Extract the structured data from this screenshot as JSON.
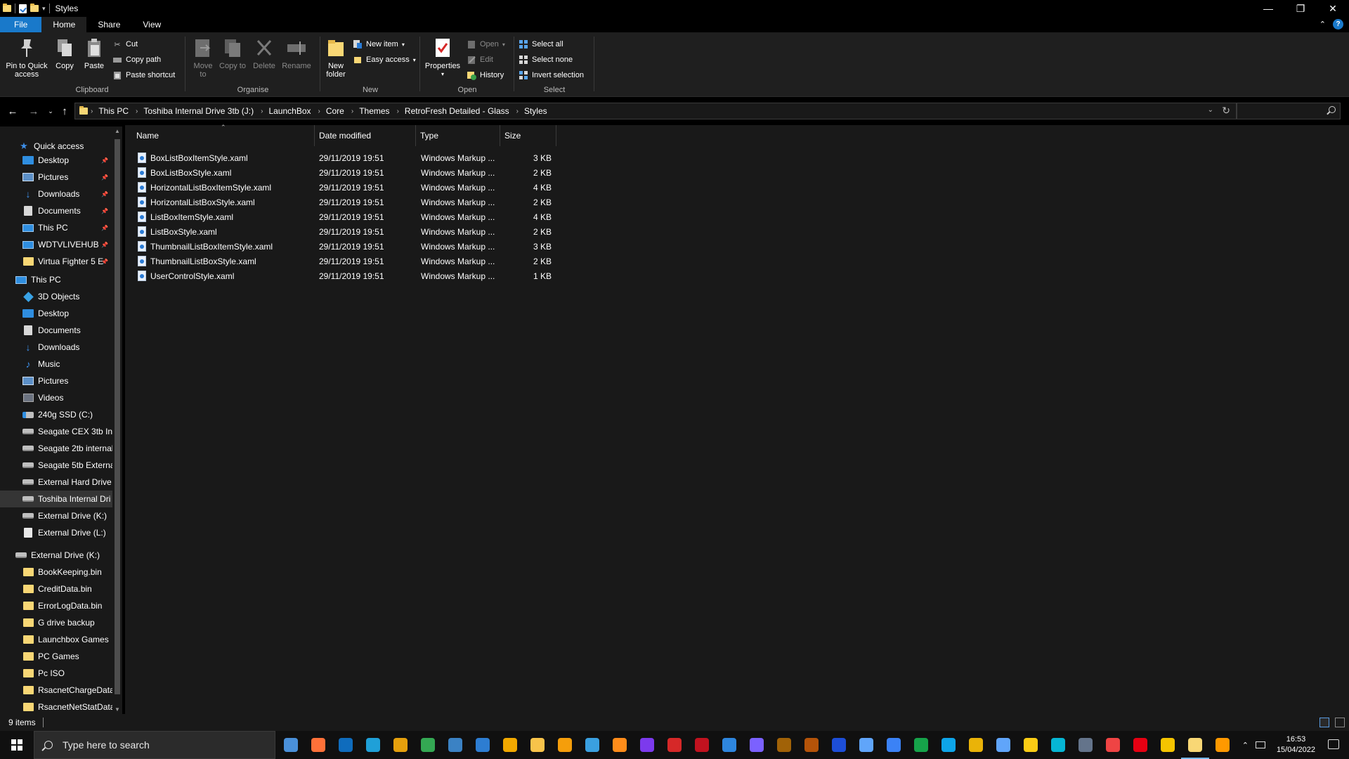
{
  "window": {
    "title": "Styles",
    "controls": {
      "minimize": "—",
      "maximize": "❐",
      "close": "✕"
    }
  },
  "ribbon_tabs": [
    {
      "label": "File"
    },
    {
      "label": "Home"
    },
    {
      "label": "Share"
    },
    {
      "label": "View"
    }
  ],
  "ribbon": {
    "clipboard": {
      "group_label": "Clipboard",
      "pin": "Pin to Quick access",
      "copy": "Copy",
      "paste": "Paste",
      "cut": "Cut",
      "copy_path": "Copy path",
      "paste_shortcut": "Paste shortcut"
    },
    "organise": {
      "group_label": "Organise",
      "move_to": "Move to",
      "copy_to": "Copy to",
      "delete": "Delete",
      "rename": "Rename"
    },
    "new": {
      "group_label": "New",
      "new_folder": "New folder",
      "new_item": "New item",
      "easy_access": "Easy access"
    },
    "open": {
      "group_label": "Open",
      "properties": "Properties",
      "open": "Open",
      "edit": "Edit",
      "history": "History"
    },
    "select": {
      "group_label": "Select",
      "select_all": "Select all",
      "select_none": "Select none",
      "invert_selection": "Invert selection"
    }
  },
  "address": {
    "breadcrumbs": [
      "This PC",
      "Toshiba Internal Drive 3tb (J:)",
      "LaunchBox",
      "Core",
      "Themes",
      "RetroFresh Detailed - Glass",
      "Styles"
    ],
    "search_placeholder": ""
  },
  "nav": {
    "quick_access": "Quick access",
    "quick_items": [
      {
        "label": "Desktop",
        "icon": "desktop-icon"
      },
      {
        "label": "Pictures",
        "icon": "pictures-icon"
      },
      {
        "label": "Downloads",
        "icon": "downloads-icon"
      },
      {
        "label": "Documents",
        "icon": "documents-icon"
      },
      {
        "label": "This PC",
        "icon": "computer-icon"
      },
      {
        "label": "WDTVLIVEHUB",
        "icon": "network-computer-icon"
      },
      {
        "label": "Virtua Fighter 5 E",
        "icon": "folder-icon"
      }
    ],
    "this_pc": "This PC",
    "pc_items": [
      {
        "label": "3D Objects",
        "icon": "3d-objects-icon"
      },
      {
        "label": "Desktop",
        "icon": "desktop-icon"
      },
      {
        "label": "Documents",
        "icon": "documents-icon"
      },
      {
        "label": "Downloads",
        "icon": "downloads-icon"
      },
      {
        "label": "Music",
        "icon": "music-icon"
      },
      {
        "label": "Pictures",
        "icon": "pictures-icon"
      },
      {
        "label": "Videos",
        "icon": "videos-icon"
      },
      {
        "label": "240g SSD (C:)",
        "icon": "system-drive-icon"
      },
      {
        "label": "Seagate CEX 3tb Int",
        "icon": "drive-icon"
      },
      {
        "label": "Seagate 2tb internal",
        "icon": "drive-icon"
      },
      {
        "label": "Seagate 5tb Externa",
        "icon": "drive-icon"
      },
      {
        "label": "External Hard Drive",
        "icon": "drive-icon"
      },
      {
        "label": "Toshiba Internal Dri",
        "icon": "drive-icon"
      },
      {
        "label": "External Drive (K:)",
        "icon": "drive-icon"
      },
      {
        "label": "External Drive (L:)",
        "icon": "usb-drive-icon"
      }
    ],
    "external": "External Drive (K:)",
    "external_items": [
      {
        "label": "BookKeeping.bin"
      },
      {
        "label": "CreditData.bin"
      },
      {
        "label": "ErrorLogData.bin"
      },
      {
        "label": "G drive backup"
      },
      {
        "label": "Launchbox Games"
      },
      {
        "label": "PC Games"
      },
      {
        "label": "Pc ISO"
      },
      {
        "label": "RsacnetChargeData"
      },
      {
        "label": "RsacnetNetStatData"
      }
    ]
  },
  "columns": {
    "name": "Name",
    "date": "Date modified",
    "type": "Type",
    "size": "Size"
  },
  "files": [
    {
      "name": "BoxListBoxItemStyle.xaml",
      "date": "29/11/2019 19:51",
      "type": "Windows Markup ...",
      "size": "3 KB"
    },
    {
      "name": "BoxListBoxStyle.xaml",
      "date": "29/11/2019 19:51",
      "type": "Windows Markup ...",
      "size": "2 KB"
    },
    {
      "name": "HorizontalListBoxItemStyle.xaml",
      "date": "29/11/2019 19:51",
      "type": "Windows Markup ...",
      "size": "4 KB"
    },
    {
      "name": "HorizontalListBoxStyle.xaml",
      "date": "29/11/2019 19:51",
      "type": "Windows Markup ...",
      "size": "2 KB"
    },
    {
      "name": "ListBoxItemStyle.xaml",
      "date": "29/11/2019 19:51",
      "type": "Windows Markup ...",
      "size": "4 KB"
    },
    {
      "name": "ListBoxStyle.xaml",
      "date": "29/11/2019 19:51",
      "type": "Windows Markup ...",
      "size": "2 KB"
    },
    {
      "name": "ThumbnailListBoxItemStyle.xaml",
      "date": "29/11/2019 19:51",
      "type": "Windows Markup ...",
      "size": "3 KB"
    },
    {
      "name": "ThumbnailListBoxStyle.xaml",
      "date": "29/11/2019 19:51",
      "type": "Windows Markup ...",
      "size": "2 KB"
    },
    {
      "name": "UserControlStyle.xaml",
      "date": "29/11/2019 19:51",
      "type": "Windows Markup ...",
      "size": "1 KB"
    }
  ],
  "status": {
    "items": "9 items"
  },
  "taskbar": {
    "search_placeholder": "Type here to search",
    "time": "16:53",
    "date": "15/04/2022",
    "apps": [
      {
        "icon": "launchbox-icon",
        "color": "#4a90d9"
      },
      {
        "icon": "firefox-icon",
        "color": "#ff7139"
      },
      {
        "icon": "outlook-icon",
        "color": "#0f6cbd"
      },
      {
        "icon": "edge-icon",
        "color": "#1fa0d8"
      },
      {
        "icon": "plex-icon",
        "color": "#e5a00d"
      },
      {
        "icon": "chrome-icon",
        "color": "#34a853"
      },
      {
        "icon": "globe-app-icon",
        "color": "#3b82c4"
      },
      {
        "icon": "store-icon",
        "color": "#2d7dd2"
      },
      {
        "icon": "triangle-app-icon",
        "color": "#f2a900"
      },
      {
        "icon": "folder-app-icon",
        "color": "#f8c34a"
      },
      {
        "icon": "cube-app-icon",
        "color": "#f59e0b"
      },
      {
        "icon": "box-app-icon",
        "color": "#3aa0e0"
      },
      {
        "icon": "fox-app-icon",
        "color": "#ff8c1a"
      },
      {
        "icon": "nox-icon",
        "color": "#7c3aed"
      },
      {
        "icon": "emulator-icon",
        "color": "#d62828"
      },
      {
        "icon": "game-app-icon",
        "color": "#c1121f"
      },
      {
        "icon": "dolphin-icon",
        "color": "#2e86de"
      },
      {
        "icon": "purple-app-icon",
        "color": "#7b61ff"
      },
      {
        "icon": "card-app-icon",
        "color": "#a16207"
      },
      {
        "icon": "card-app-2-icon",
        "color": "#b45309"
      },
      {
        "icon": "r-app-icon",
        "color": "#1d4ed8"
      },
      {
        "icon": "diamond-app-icon",
        "color": "#60a5fa"
      },
      {
        "icon": "bluetooth-app-icon",
        "color": "#3b82f6"
      },
      {
        "icon": "green-app-icon",
        "color": "#16a34a"
      },
      {
        "icon": "window-app-icon",
        "color": "#0ea5e9"
      },
      {
        "icon": "yellow-app-icon",
        "color": "#eab308"
      },
      {
        "icon": "bluetooth-2-icon",
        "color": "#60a5fa"
      },
      {
        "icon": "lemon-app-icon",
        "color": "#facc15"
      },
      {
        "icon": "c-app-icon",
        "color": "#06b6d4"
      },
      {
        "icon": "rocket-app-icon",
        "color": "#64748b"
      },
      {
        "icon": "bar-app-icon",
        "color": "#ef4444"
      },
      {
        "icon": "switch-red-icon",
        "color": "#e60012"
      },
      {
        "icon": "switch-yellow-icon",
        "color": "#f5c400"
      },
      {
        "icon": "file-explorer-icon",
        "color": "#f8d775"
      },
      {
        "icon": "launchbox-2-icon",
        "color": "#ff9900"
      }
    ]
  }
}
